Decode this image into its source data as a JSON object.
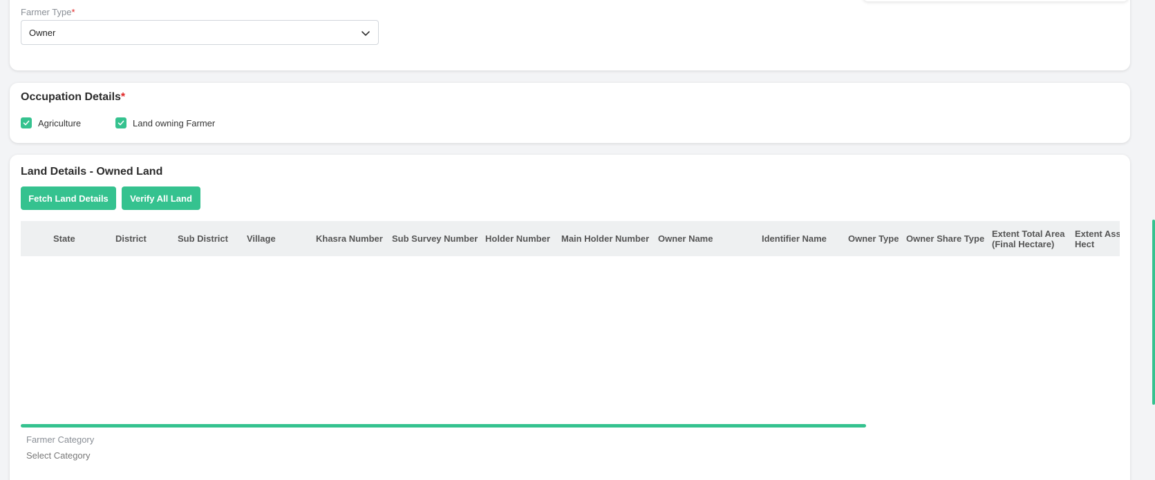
{
  "farmer_type": {
    "label": "Farmer Type",
    "required_mark": "*",
    "selected": "Owner"
  },
  "occupation": {
    "title": "Occupation Details",
    "required_mark": "*",
    "options": [
      {
        "label": "Agriculture",
        "checked": true
      },
      {
        "label": "Land owning Farmer",
        "checked": true
      }
    ]
  },
  "land_details": {
    "title": "Land Details - Owned Land",
    "fetch_button": "Fetch Land Details",
    "verify_button": "Verify All Land",
    "columns": [
      "State",
      "District",
      "Sub District",
      "Village",
      "Khasra Number",
      "Sub Survey Number",
      "Holder Number",
      "Main Holder Number",
      "Owner Name",
      "Identifier Name",
      "Owner Type",
      "Owner Share Type",
      "Extent Total Area (Final Hectare)",
      "Extent Ass (Final Hect"
    ],
    "rows": []
  },
  "farmer_category": {
    "label": "Farmer Category",
    "placeholder": "Select Category"
  },
  "colors": {
    "accent": "#35c28f",
    "required": "#e02424",
    "header_bg": "#eef0f1"
  }
}
